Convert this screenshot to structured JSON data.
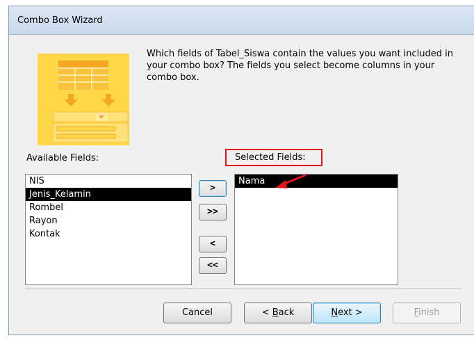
{
  "window": {
    "title": "Combo Box Wizard"
  },
  "intro": {
    "text": "Which fields of Tabel_Siswa contain the values you want included in your combo box? The fields you select become columns in your combo box."
  },
  "available": {
    "label": "Available Fields:",
    "items": [
      {
        "label": "NIS",
        "selected": false
      },
      {
        "label": "Jenis_Kelamin",
        "selected": true
      },
      {
        "label": "Rombel",
        "selected": false
      },
      {
        "label": "Rayon",
        "selected": false
      },
      {
        "label": "Kontak",
        "selected": false
      }
    ]
  },
  "selected": {
    "label": "Selected Fields:",
    "items": [
      {
        "label": "Nama",
        "selected": true
      }
    ]
  },
  "move_buttons": {
    "add": ">",
    "add_all": ">>",
    "remove": "<",
    "remove_all": "<<"
  },
  "footer": {
    "cancel": "Cancel",
    "back_prefix": "< ",
    "back_mnemonic": "B",
    "back_rest": "ack",
    "next_mnemonic": "N",
    "next_rest": "ext >",
    "finish_mnemonic": "F",
    "finish_rest": "inish"
  },
  "colors": {
    "annotation": "#e1141c",
    "image_bg": "#ffd84a",
    "image_accent": "#f5a623"
  },
  "icons": {
    "wizard_graphic": "combo-box-wizard-graphic",
    "annotation_arrow": "red-arrow"
  }
}
